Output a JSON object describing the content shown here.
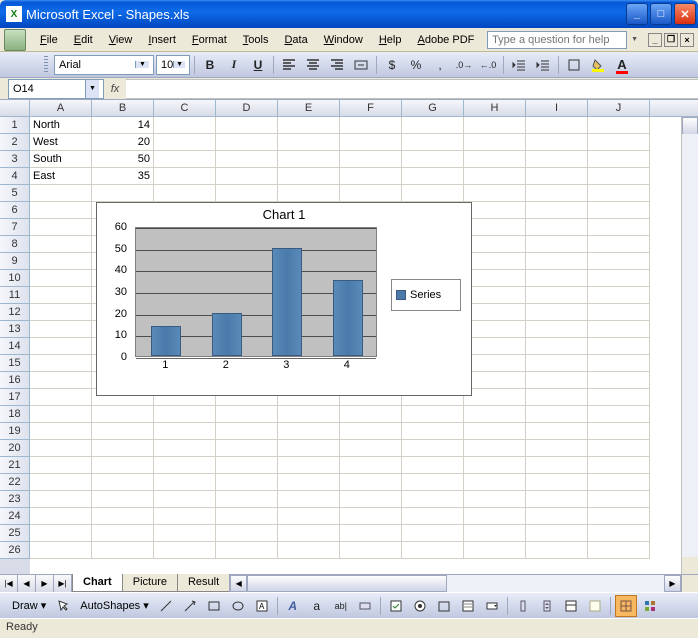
{
  "title_bar": {
    "app_icon_text": "X",
    "title": "Microsoft Excel - Shapes.xls"
  },
  "menu": {
    "excel_icon_text": "",
    "items": [
      "File",
      "Edit",
      "View",
      "Insert",
      "Format",
      "Tools",
      "Data",
      "Window",
      "Help",
      "Adobe PDF"
    ],
    "help_placeholder": "Type a question for help"
  },
  "format_toolbar": {
    "font_name": "Arial",
    "font_size": "10",
    "bold": "B",
    "italic": "I",
    "underline": "U",
    "currency": "$",
    "percent": "%",
    "comma": ","
  },
  "formula_bar": {
    "name_box": "O14",
    "fx": "fx",
    "formula": ""
  },
  "columns": [
    "A",
    "B",
    "C",
    "D",
    "E",
    "F",
    "G",
    "H",
    "I",
    "J"
  ],
  "row_count": 26,
  "data_cells": {
    "A1": "North",
    "B1": "14",
    "A2": "West",
    "B2": "20",
    "A3": "South",
    "B3": "50",
    "A4": "East",
    "B4": "35"
  },
  "sheet_tabs": {
    "active": "Chart",
    "tabs": [
      "Chart",
      "Picture",
      "Result"
    ]
  },
  "drawing_toolbar": {
    "draw_label": "Draw ▾",
    "autoshapes_label": "AutoShapes ▾",
    "text_icons": [
      "A",
      "a",
      "ab|"
    ]
  },
  "status_bar": {
    "text": "Ready"
  },
  "chart_data": {
    "type": "bar",
    "title": "Chart 1",
    "categories": [
      "1",
      "2",
      "3",
      "4"
    ],
    "series": [
      {
        "name": "Series",
        "values": [
          14,
          20,
          50,
          35
        ]
      }
    ],
    "ylabel": "",
    "xlabel": "",
    "ylim": [
      0,
      60
    ],
    "yticks": [
      0,
      10,
      20,
      30,
      40,
      50,
      60
    ],
    "legend": "Series"
  }
}
